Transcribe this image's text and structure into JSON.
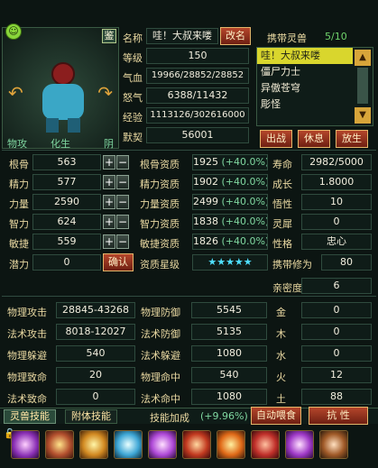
{
  "header": {
    "name_label": "名称",
    "name_value": "哇！大叔来喽",
    "rename_button": "改名",
    "level_label": "等级",
    "level_value": "150",
    "hp_label": "气血",
    "hp_value": "19966/28852/28852",
    "mana_label": "怒气",
    "mana_value": "6388/11432",
    "exp_label": "经验",
    "exp_value": "1113126/302616000",
    "tacit_label": "默契",
    "tacit_value": "56001",
    "appraise_badge": "鉴",
    "attr_left": "物攻",
    "attr_mid": "化生",
    "attr_right": "阴"
  },
  "pets": {
    "title": "携带灵兽",
    "count": "5/10",
    "items": [
      "哇！大叔来喽",
      "僵尸力士",
      "异傲苍穹",
      "彫怪"
    ],
    "buttons": [
      "出战",
      "休息",
      "放生"
    ]
  },
  "base": [
    {
      "label": "根骨",
      "value": "563",
      "aptitude_label": "根骨资质",
      "aptitude": "1925",
      "bonus": "(+40.0%)"
    },
    {
      "label": "精力",
      "value": "577",
      "aptitude_label": "精力资质",
      "aptitude": "1902",
      "bonus": "(+40.0%)"
    },
    {
      "label": "力量",
      "value": "2590",
      "aptitude_label": "力量资质",
      "aptitude": "2499",
      "bonus": "(+40.0%)"
    },
    {
      "label": "智力",
      "value": "624",
      "aptitude_label": "智力资质",
      "aptitude": "1838",
      "bonus": "(+40.0%)"
    },
    {
      "label": "敏捷",
      "value": "559",
      "aptitude_label": "敏捷资质",
      "aptitude": "1826",
      "bonus": "(+40.0%)"
    }
  ],
  "right_stats": [
    {
      "label": "寿命",
      "value": "2982/5000"
    },
    {
      "label": "成长",
      "value": "1.8000"
    },
    {
      "label": "悟性",
      "value": "10"
    },
    {
      "label": "灵犀",
      "value": "0"
    },
    {
      "label": "性格",
      "value": "忠心"
    },
    {
      "label": "携带修为",
      "value": "80"
    },
    {
      "label": "亲密度",
      "value": "6"
    }
  ],
  "potential": {
    "label": "潜力",
    "value": "0",
    "confirm": "确认",
    "star_label": "资质星级",
    "stars": "★★★★★"
  },
  "combat": [
    {
      "label": "物理攻击",
      "value": "28845-43268",
      "label2": "物理防御",
      "value2": "5545",
      "el_label": "金",
      "el_value": "0"
    },
    {
      "label": "法术攻击",
      "value": "8018-12027",
      "label2": "法术防御",
      "value2": "5135",
      "el_label": "木",
      "el_value": "0"
    },
    {
      "label": "物理躲避",
      "value": "540",
      "label2": "法术躲避",
      "value2": "1080",
      "el_label": "水",
      "el_value": "0"
    },
    {
      "label": "物理致命",
      "value": "20",
      "label2": "物理命中",
      "value2": "540",
      "el_label": "火",
      "el_value": "12"
    },
    {
      "label": "法术致命",
      "value": "0",
      "label2": "法术命中",
      "value2": "1080",
      "el_label": "土",
      "el_value": "88"
    }
  ],
  "bottom": {
    "tab1": "灵兽技能",
    "tab2": "附体技能",
    "skill_bonus_label": "技能加成",
    "skill_bonus_value": "(+9.96%)",
    "auto_feed": "自动喂食",
    "resist": "抗 性"
  },
  "colors": {
    "accent": "#b5462b",
    "gold": "#ead9a2",
    "green": "#7fd7a0",
    "stars": "#4fe0ff"
  }
}
